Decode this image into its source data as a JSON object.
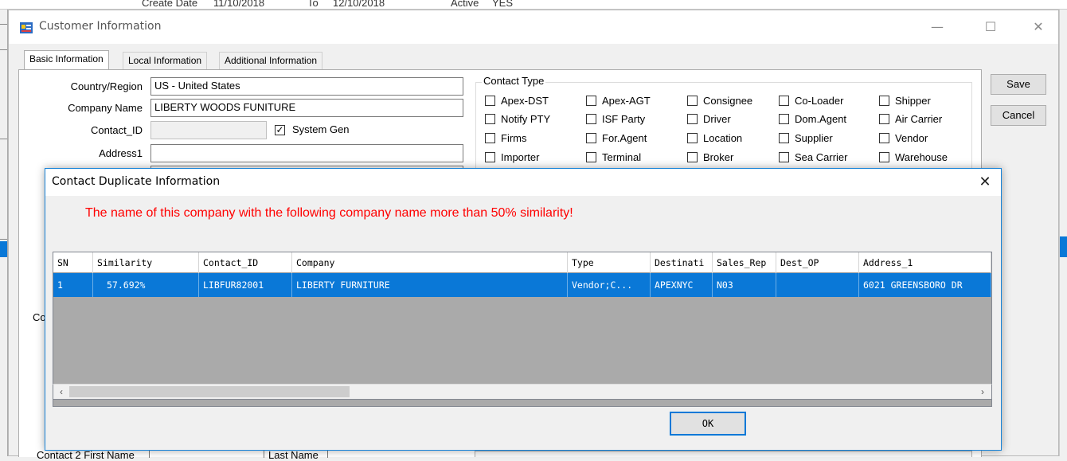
{
  "bg": {
    "create_date_label": "Create Date",
    "create_date_value": "11/10/2018",
    "to_label": "To",
    "to_value": "12/10/2018",
    "active_label": "Active",
    "active_value": "YES"
  },
  "window": {
    "title": "Customer Information",
    "minimize": "—",
    "maximize": "☐",
    "close": "✕"
  },
  "tabs": [
    {
      "label": "Basic Information"
    },
    {
      "label": "Local Information"
    },
    {
      "label": "Additional Information"
    }
  ],
  "form": {
    "country_label": "Country/Region",
    "country_value": "US - United States",
    "company_label": "Company Name",
    "company_value": "LIBERTY WOODS FUNITURE",
    "contact_id_label": "Contact_ID",
    "contact_id_value": "",
    "system_gen_label": "System Gen",
    "system_gen_checked": true,
    "address1_label": "Address1",
    "address1_value": "",
    "contact2_first_label": "Contact 2 First Name",
    "last_name_label": "Last Name",
    "partial_label_co": "Co"
  },
  "contact_type": {
    "title": "Contact Type",
    "items": [
      [
        "Apex-DST",
        "Apex-AGT",
        "Consignee",
        "Co-Loader",
        "Shipper"
      ],
      [
        "Notify PTY",
        "ISF Party",
        "Driver",
        "Dom.Agent",
        "Air Carrier"
      ],
      [
        "Firms",
        "For.Agent",
        "Location",
        "Supplier",
        "Vendor"
      ],
      [
        "Importer",
        "Terminal",
        "Broker",
        "Sea Carrier",
        "Warehouse"
      ]
    ]
  },
  "buttons": {
    "save": "Save",
    "cancel": "Cancel"
  },
  "dialog": {
    "title": "Contact Duplicate Information",
    "close": "✕",
    "message": "The name of this company with the following company name more than 50% similarity!",
    "columns": [
      "SN",
      "Similarity",
      "Contact_ID",
      "Company",
      "Type",
      "Destinati",
      "Sales_Rep",
      "Dest_OP",
      "Address_1"
    ],
    "rows": [
      [
        "1",
        "57.692%",
        "LIBFUR82001",
        "LIBERTY FURNITURE",
        "Vendor;C...",
        "APEXNYC",
        "N03",
        "",
        "6021 GREENSBORO DR"
      ]
    ],
    "scroll_left": "‹",
    "scroll_right": "›",
    "ok": "OK"
  }
}
